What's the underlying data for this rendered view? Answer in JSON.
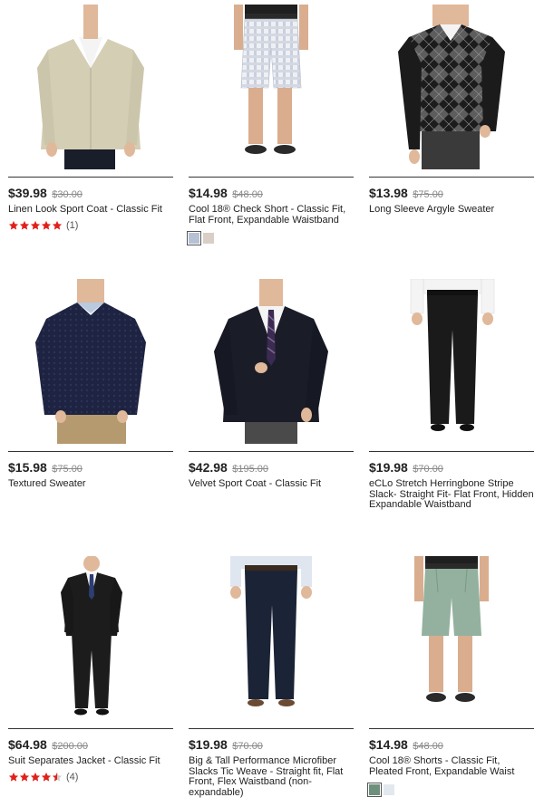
{
  "products": [
    {
      "price": "$39.98",
      "original": "$30.00",
      "title": "Linen Look Sport Coat - Classic Fit",
      "rating": {
        "stars": 5,
        "count": "(1)"
      },
      "swatches": []
    },
    {
      "price": "$14.98",
      "original": "$48.00",
      "title": "Cool 18® Check Short - Classic Fit, Flat Front, Expandable Waistband",
      "rating": null,
      "swatches": [
        "#b7c1d4",
        "#d9cfc6"
      ]
    },
    {
      "price": "$13.98",
      "original": "$75.00",
      "title": "Long Sleeve Argyle Sweater",
      "rating": null,
      "swatches": []
    },
    {
      "price": "$15.98",
      "original": "$75.00",
      "title": "Textured Sweater",
      "rating": null,
      "swatches": []
    },
    {
      "price": "$42.98",
      "original": "$195.00",
      "title": "Velvet Sport Coat - Classic Fit",
      "rating": null,
      "swatches": []
    },
    {
      "price": "$19.98",
      "original": "$70.00",
      "title": "eCLo Stretch Herringbone Stripe Slack- Straight Fit- Flat Front, Hidden Expandable Waistband",
      "rating": null,
      "swatches": []
    },
    {
      "price": "$64.98",
      "original": "$200.00",
      "title": "Suit Separates Jacket - Classic Fit",
      "rating": {
        "stars": 4.5,
        "count": "(4)"
      },
      "swatches": []
    },
    {
      "price": "$19.98",
      "original": "$70.00",
      "title": "Big & Tall Performance Microfiber Slacks Tic Weave - Straight fit, Flat Front, Flex Waistband (non-expandable)",
      "rating": null,
      "swatches": []
    },
    {
      "price": "$14.98",
      "original": "$48.00",
      "title": "Cool 18® Shorts - Classic Fit, Pleated Front, Expandable Waist",
      "rating": null,
      "swatches": [
        "#6f8f7d",
        "#e3e8ee"
      ]
    }
  ],
  "icons": {
    "rating": "star-icon"
  },
  "colors": {
    "star": "#e0201b",
    "text": "#222222",
    "strike": "#888888",
    "rule": "#333333"
  }
}
